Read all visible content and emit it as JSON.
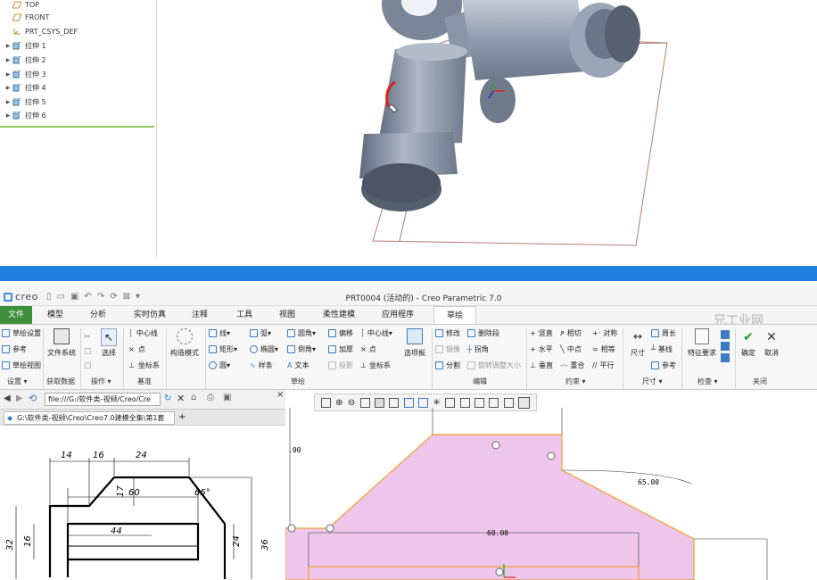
{
  "model_tree": {
    "items": [
      {
        "label": "TOP",
        "icon": "datum-plane-icon"
      },
      {
        "label": "FRONT",
        "icon": "datum-plane-icon"
      },
      {
        "label": "PRT_CSYS_DEF",
        "icon": "csys-icon"
      },
      {
        "label": "拉伸 1",
        "icon": "extrude-icon"
      },
      {
        "label": "拉伸 2",
        "icon": "extrude-icon"
      },
      {
        "label": "拉伸 3",
        "icon": "extrude-icon"
      },
      {
        "label": "拉伸 4",
        "icon": "extrude-icon"
      },
      {
        "label": "拉伸 5",
        "icon": "extrude-icon"
      },
      {
        "label": "拉伸 6",
        "icon": "extrude-icon"
      }
    ]
  },
  "app": {
    "logo": "creo",
    "title": "PRT0004 (活动的) - Creo Parametric 7.0",
    "watermark": "兄工业网"
  },
  "menu": {
    "tabs": [
      "文件",
      "模型",
      "分析",
      "实时仿真",
      "注释",
      "工具",
      "视图",
      "柔性建模",
      "应用程序",
      "草绘"
    ],
    "active": "草绘"
  },
  "ribbon": {
    "setup": [
      "草绘设置",
      "参考",
      "草绘视图"
    ],
    "file_system": "文件系统",
    "select": "选择",
    "datum": [
      "中心线",
      "点",
      "坐标系"
    ],
    "construction": "构造模式",
    "sketch_rows": [
      [
        "线",
        "弧",
        "圆角",
        "偏移",
        "中心线"
      ],
      [
        "矩形",
        "椭圆",
        "倒角",
        "加厚",
        "点"
      ],
      [
        "圆",
        "样条",
        "文本",
        "投影",
        "坐标系"
      ]
    ],
    "palette": "选项板",
    "edit": [
      "修改",
      "删除段",
      "镜像",
      "拐角",
      "分割",
      "旋转调整大小"
    ],
    "constrain": [
      [
        "竖直",
        "相切",
        "对称"
      ],
      [
        "水平",
        "中点",
        "相等"
      ],
      [
        "垂直",
        "重合",
        "平行"
      ]
    ],
    "dimension": [
      "尺寸",
      "周长",
      "基线",
      "参考"
    ],
    "inspect": "特征要求",
    "ok": "确定",
    "cancel": "取消",
    "groups": [
      "设置",
      "获取数据",
      "操作",
      "基准",
      "草绘",
      "编辑",
      "约束",
      "尺寸",
      "检查",
      "关闭"
    ]
  },
  "browser": {
    "address": "file:///G:/软件类-视频/Creo/Cre",
    "tab": "G:\\软件类-视频\\Creo\\Creo7.0建模全集\\第1套"
  },
  "drawing": {
    "dims": [
      "14",
      "16",
      "24",
      "65°",
      "17",
      "60",
      "32",
      "16",
      "24",
      "36",
      "44"
    ]
  },
  "sketch": {
    "dims": [
      ".00",
      "65.00",
      "60.00"
    ]
  }
}
